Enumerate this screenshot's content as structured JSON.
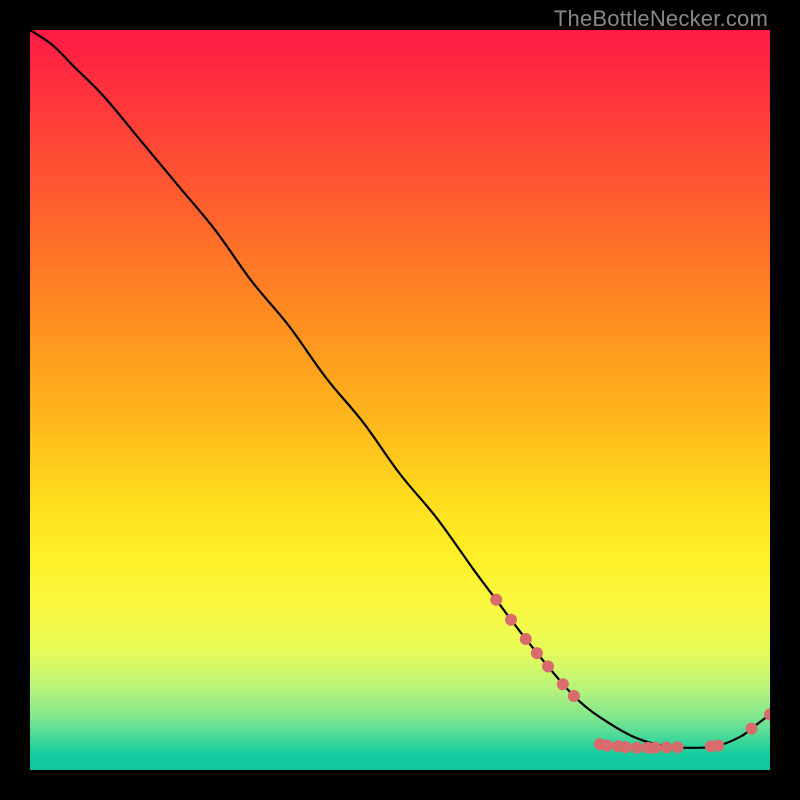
{
  "watermark": "TheBottleNecker.com",
  "chart_data": {
    "type": "line",
    "title": "",
    "xlabel": "",
    "ylabel": "",
    "xlim": [
      0,
      100
    ],
    "ylim": [
      0,
      100
    ],
    "series": [
      {
        "name": "curve",
        "x": [
          0,
          3,
          6,
          10,
          15,
          20,
          25,
          30,
          35,
          40,
          45,
          50,
          55,
          60,
          63,
          66,
          70,
          74,
          78,
          82,
          86,
          90,
          93,
          96,
          98,
          100
        ],
        "y": [
          100,
          98,
          95,
          91,
          85,
          79,
          73,
          66,
          60,
          53,
          47,
          40,
          34,
          27,
          23,
          19,
          14,
          9.5,
          6.5,
          4.3,
          3.2,
          3.0,
          3.3,
          4.5,
          6.0,
          7.5
        ]
      }
    ],
    "markers": [
      {
        "x": 63,
        "y": 23
      },
      {
        "x": 65,
        "y": 20.3
      },
      {
        "x": 67,
        "y": 17.7
      },
      {
        "x": 68.5,
        "y": 15.8
      },
      {
        "x": 70,
        "y": 14.0
      },
      {
        "x": 72,
        "y": 11.6
      },
      {
        "x": 73.5,
        "y": 10.0
      },
      {
        "x": 77,
        "y": 3.5
      },
      {
        "x": 78,
        "y": 3.3
      },
      {
        "x": 79.5,
        "y": 3.2
      },
      {
        "x": 80.5,
        "y": 3.1
      },
      {
        "x": 82,
        "y": 3.0
      },
      {
        "x": 83.5,
        "y": 3.0
      },
      {
        "x": 84.5,
        "y": 3.0
      },
      {
        "x": 86,
        "y": 3.05
      },
      {
        "x": 87.5,
        "y": 3.1
      },
      {
        "x": 92,
        "y": 3.2
      },
      {
        "x": 93,
        "y": 3.3
      },
      {
        "x": 97.5,
        "y": 5.6
      },
      {
        "x": 100,
        "y": 7.5
      }
    ],
    "style": {
      "line_color": "#000000",
      "marker_color": "#d86b6b",
      "marker_radius_px": 6
    }
  }
}
